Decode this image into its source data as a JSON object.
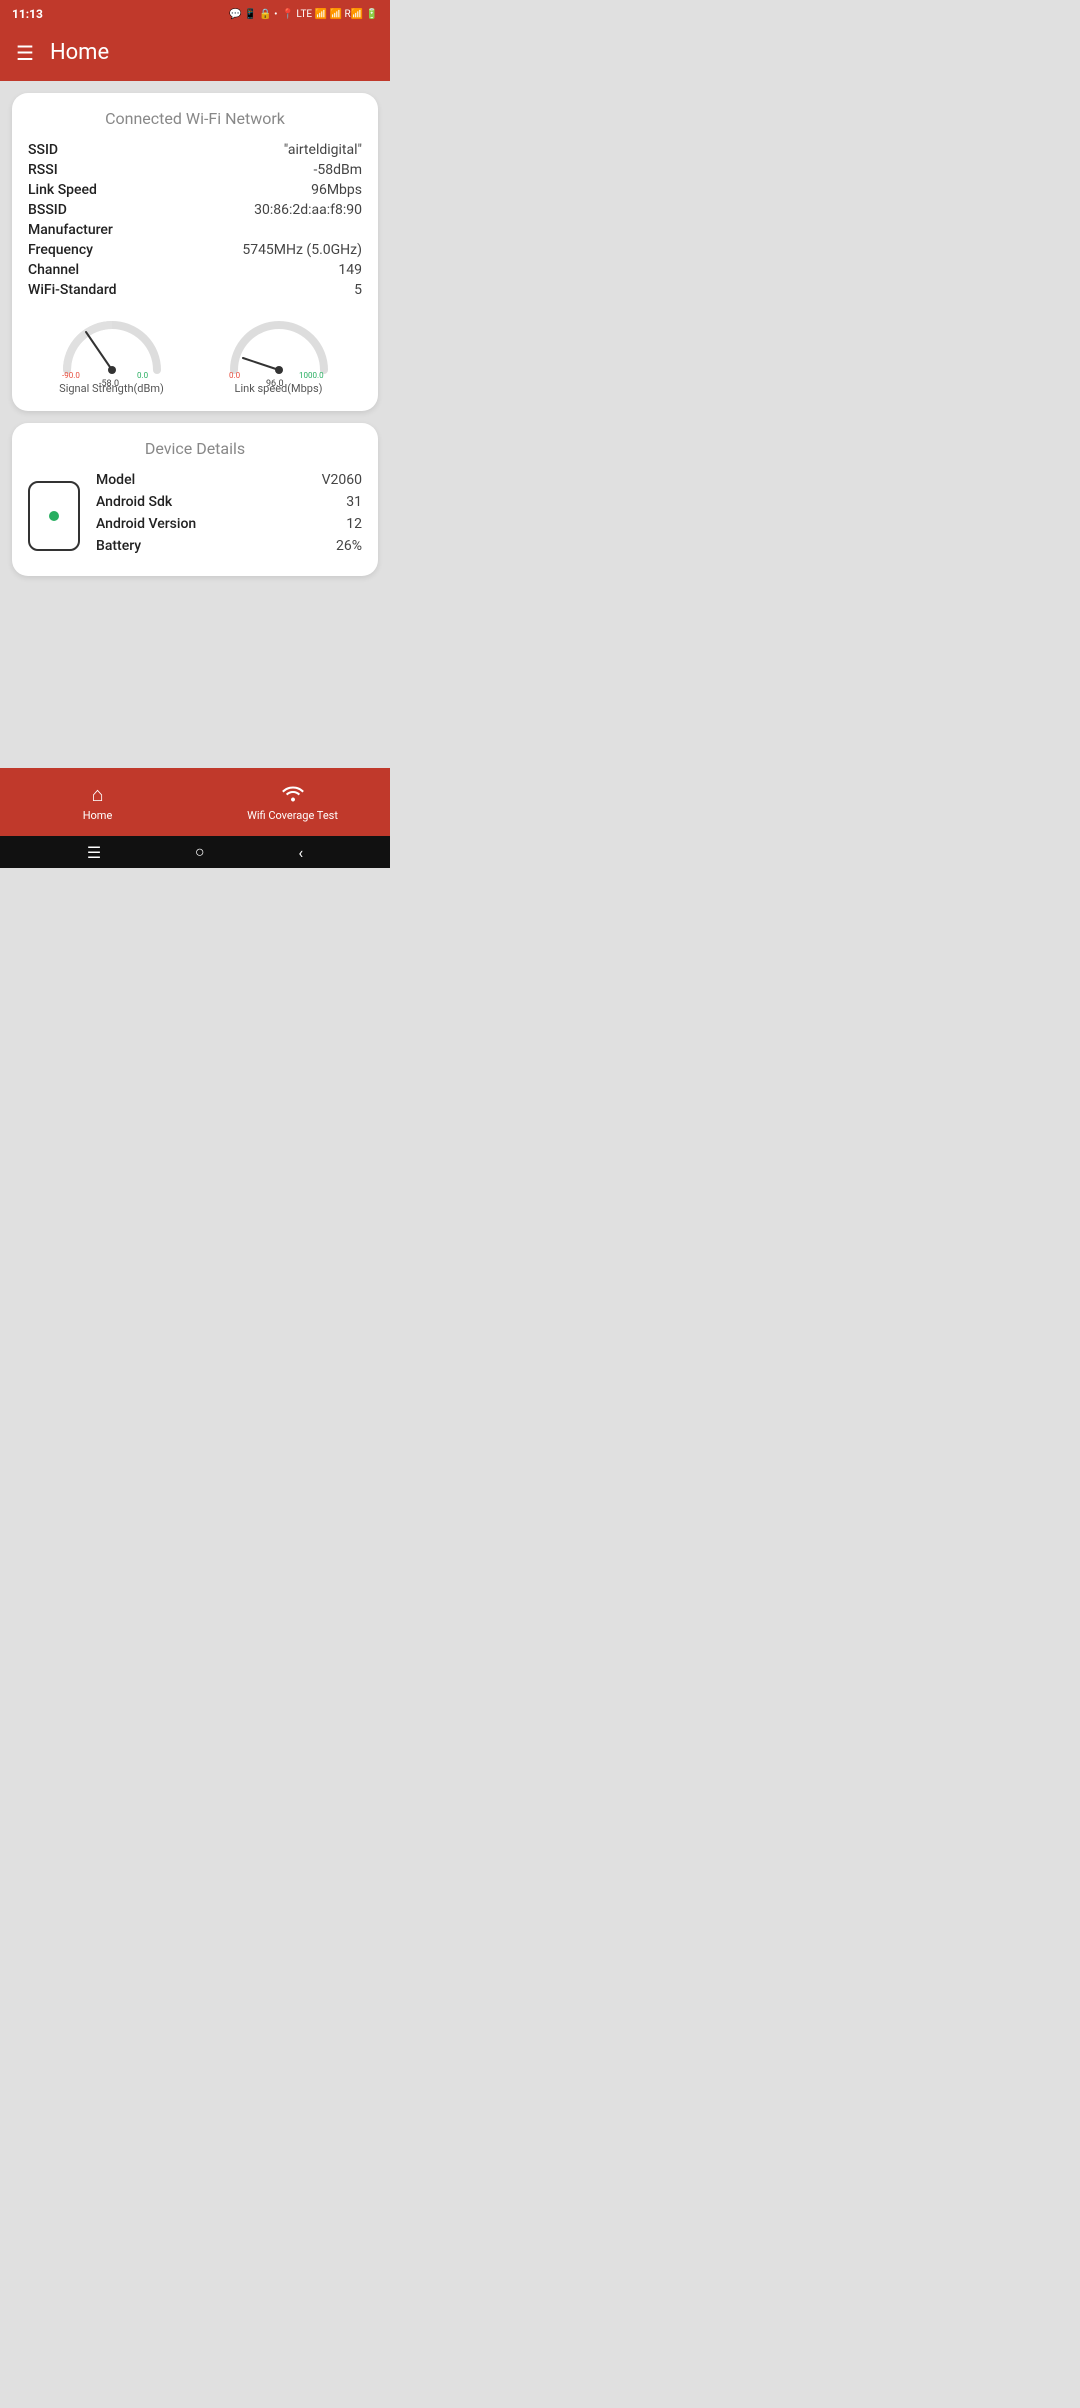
{
  "statusBar": {
    "time": "11:13",
    "icons": [
      "💬",
      "📱",
      "🔒",
      "•"
    ]
  },
  "header": {
    "title": "Home"
  },
  "wifiCard": {
    "title": "Connected Wi-Fi Network",
    "fields": [
      {
        "label": "SSID",
        "value": "\"airteldigital\""
      },
      {
        "label": "RSSI",
        "value": "-58dBm"
      },
      {
        "label": "Link Speed",
        "value": "96Mbps"
      },
      {
        "label": "BSSID",
        "value": "30:86:2d:aa:f8:90"
      },
      {
        "label": "Manufacturer",
        "value": ""
      },
      {
        "label": "Frequency",
        "value": "5745MHz (5.0GHz)"
      },
      {
        "label": "Channel",
        "value": "149"
      },
      {
        "label": "WiFi-Standard",
        "value": "5"
      }
    ],
    "signalGauge": {
      "label": "Signal Strength(dBm)",
      "value": -58.0,
      "min": -90.0,
      "max": 0.0,
      "displayValue": "-58.0"
    },
    "linkSpeedGauge": {
      "label": "Link speed(Mbps)",
      "value": 96.0,
      "min": 0.0,
      "max": 1000.0,
      "displayValue": "96.0"
    }
  },
  "deviceCard": {
    "title": "Device Details",
    "fields": [
      {
        "label": "Model",
        "value": "V2060"
      },
      {
        "label": "Android Sdk",
        "value": "31"
      },
      {
        "label": "Android Version",
        "value": "12"
      },
      {
        "label": "Battery",
        "value": "26%"
      }
    ]
  },
  "bottomNav": {
    "items": [
      {
        "id": "home",
        "label": "Home",
        "icon": "home"
      },
      {
        "id": "wifi-coverage",
        "label": "Wifi Coverage Test",
        "icon": "wifi"
      }
    ]
  },
  "systemNav": {
    "buttons": [
      "menu",
      "circle",
      "back"
    ]
  },
  "colors": {
    "primary": "#c0392b",
    "background": "#e0e0e0",
    "cardBg": "#ffffff"
  }
}
